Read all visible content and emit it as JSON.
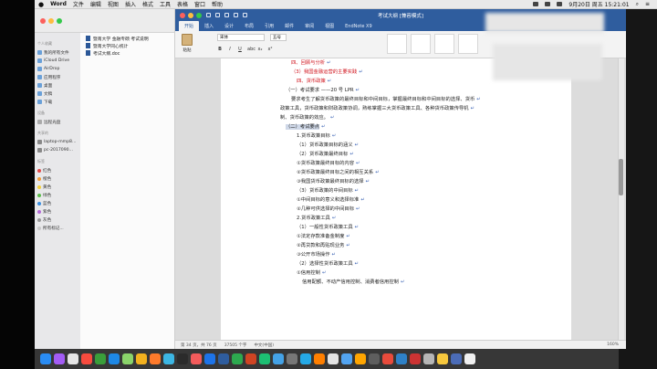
{
  "menubar": {
    "apple": "",
    "app": "Word",
    "items": [
      "文件",
      "编辑",
      "视图",
      "插入",
      "格式",
      "工具",
      "表格",
      "窗口",
      "帮助"
    ],
    "datetime": "9月20日 周五 15:21:01"
  },
  "finder": {
    "sections": {
      "personal": "个人收藏",
      "devices": "设备",
      "shared": "共享的",
      "tags": "标签"
    },
    "favorites": [
      "我的所有文件",
      "iCloud Drive",
      "AirDrop",
      "应用程序",
      "桌面",
      "文稿",
      "下载"
    ],
    "devices": [
      "远程光盘"
    ],
    "shared": [
      "laptop-mmp8...",
      "pc-2017090..."
    ],
    "tags": [
      {
        "label": "红色",
        "color": "#e24a4a"
      },
      {
        "label": "橙色",
        "color": "#f29d38"
      },
      {
        "label": "黄色",
        "color": "#f2cf3b"
      },
      {
        "label": "绿色",
        "color": "#5bbd4c"
      },
      {
        "label": "蓝色",
        "color": "#3b8fe0"
      },
      {
        "label": "紫色",
        "color": "#b46bd6"
      },
      {
        "label": "灰色",
        "color": "#9a9a9a"
      },
      {
        "label": "所有标记...",
        "color": "#c8c8c8"
      }
    ],
    "files": [
      "暨南大学 金融专硕 考试说明",
      "暨南大学同心统计",
      "考试大纲.doc"
    ]
  },
  "word": {
    "title": "考试大纲 [兼容模式]",
    "tabs": [
      "开始",
      "插入",
      "设计",
      "布局",
      "引用",
      "邮件",
      "审阅",
      "视图",
      "EndNote X9"
    ],
    "active_tab": "开始",
    "ribbon": {
      "paste_label": "粘贴",
      "font_name": "宋体",
      "font_size": "五号",
      "format_buttons": [
        "B",
        "I",
        "U",
        "abc",
        "x₂",
        "x²"
      ]
    },
    "document_lines": [
      {
        "text": "四、货币政策",
        "style": "red",
        "indent": 3
      },
      {
        "text": "（一）考试要求 ——20 号 LPR",
        "style": "normal",
        "indent": 1
      },
      {
        "text": "要求考生了解货币政策的最终目标和中间目标，掌握最终目标和中间目标的选择、货币",
        "style": "normal",
        "indent": 2
      },
      {
        "text": "政策工具，货币政策和财政政策协调，熟练掌握三大货币政策工具、各种货币政策传导机",
        "style": "normal",
        "indent": 0
      },
      {
        "text": "制、货币政策的效应。",
        "style": "normal",
        "indent": 0
      },
      {
        "text": "（二）考试要点",
        "style": "hl",
        "indent": 1
      },
      {
        "text": "1.货币政策目标",
        "style": "normal",
        "indent": 3
      },
      {
        "text": "（1）货币政策目标的涵义",
        "style": "normal",
        "indent": 3
      },
      {
        "text": "（2）货币政策最终目标",
        "style": "normal",
        "indent": 3
      },
      {
        "text": "①货币政策最终目标的内容",
        "style": "normal",
        "indent": 3
      },
      {
        "text": "②货币政策最终目标之间的相互关系",
        "style": "normal",
        "indent": 3
      },
      {
        "text": "③我国货币政策最终目标的选择",
        "style": "normal",
        "indent": 3
      },
      {
        "text": "（3）货币政策的中间目标",
        "style": "normal",
        "indent": 3
      },
      {
        "text": "①中间目标的意义和选择标准",
        "style": "normal",
        "indent": 3
      },
      {
        "text": "②几种可供选择的中间目标",
        "style": "normal",
        "indent": 3
      },
      {
        "text": "2.货币政策工具",
        "style": "normal",
        "indent": 3
      },
      {
        "text": "（1）一般性货币政策工具",
        "style": "normal",
        "indent": 3
      },
      {
        "text": "①法定存款准备金制度",
        "style": "normal",
        "indent": 3
      },
      {
        "text": "②再贷款和再贴现业务",
        "style": "normal",
        "indent": 3
      },
      {
        "text": "③公开市场操作",
        "style": "normal",
        "indent": 3
      },
      {
        "text": "（2）选择性货币政策工具",
        "style": "normal",
        "indent": 3
      },
      {
        "text": "①信用控制",
        "style": "normal",
        "indent": 3
      },
      {
        "text": "信用配额、不动产信用控制、消费者信用控制",
        "style": "normal",
        "indent": 4
      }
    ],
    "top_lines": [
      {
        "text": "四、回顾与分析",
        "style": "red"
      },
      {
        "text": "（3）我国金融运营的主要实践",
        "style": "red"
      }
    ],
    "status": {
      "page": "第 34 页，共 76 页",
      "words": "37505 个字",
      "language": "中文(中国)",
      "zoom": "160%"
    }
  },
  "dock_colors": [
    "#2a8cf3",
    "#a35cf5",
    "#e5e5e5",
    "#f74b3e",
    "#3a9e3a",
    "#1e88e5",
    "#8ad36a",
    "#f2b01e",
    "#fe7a2b",
    "#3cb6e3",
    "#2b2b2b",
    "#f35b5b",
    "#1d73e8",
    "#2f5d9e",
    "#2da94f",
    "#d04423",
    "#1dbf73",
    "#44a2e6",
    "#777777",
    "#25a9e6",
    "#ff7f00",
    "#e4e4e4",
    "#53a4f0",
    "#ffa500",
    "#5e5e5e",
    "#e84b3c",
    "#2e81c7",
    "#cc3333",
    "#b6b6b6",
    "#f7c83d",
    "#4b6cb7",
    "#f0f0f0"
  ]
}
